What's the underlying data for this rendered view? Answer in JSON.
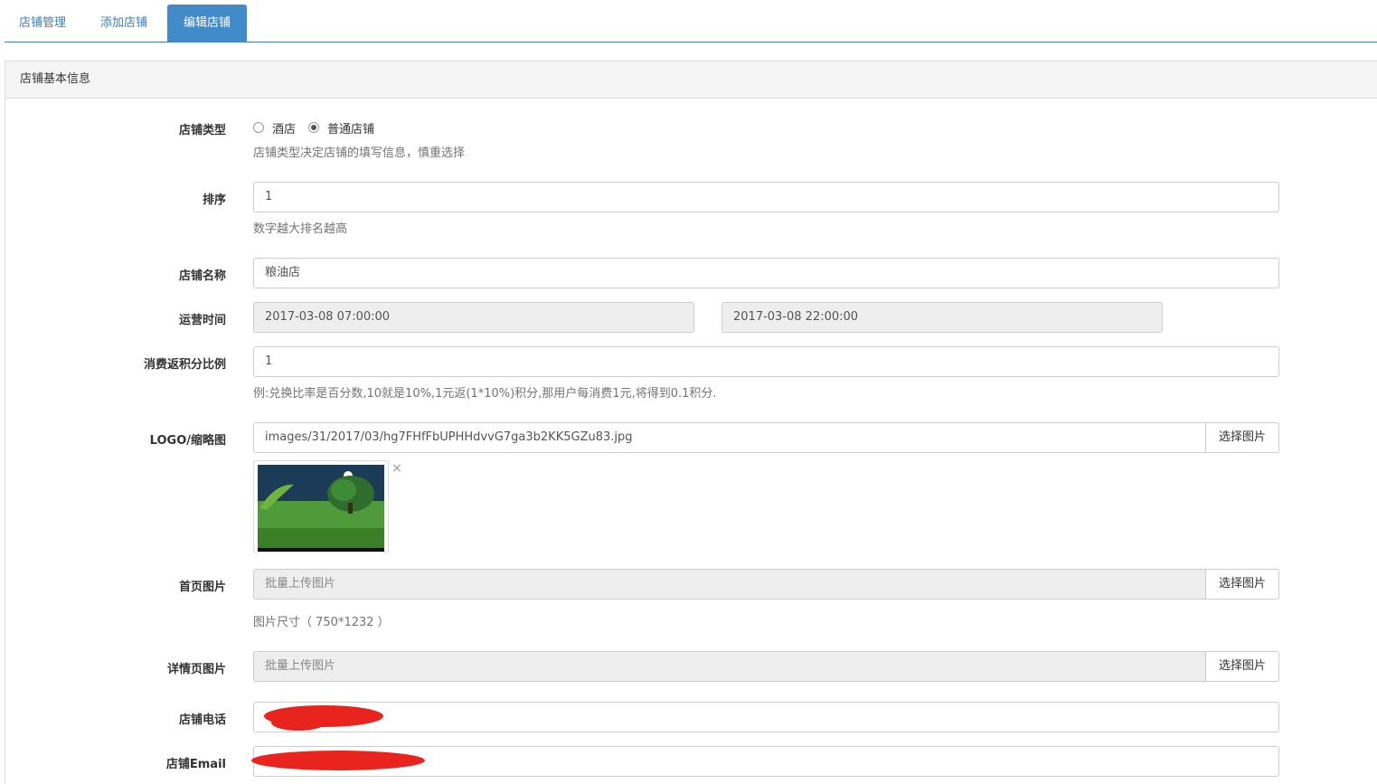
{
  "tabs": [
    {
      "label": "店铺管理"
    },
    {
      "label": "添加店铺"
    },
    {
      "label": "编辑店铺"
    }
  ],
  "panel": {
    "title": "店铺基本信息"
  },
  "form": {
    "store_type": {
      "label": "店铺类型",
      "options": [
        "酒店",
        "普通店铺"
      ],
      "selected": "普通店铺",
      "help": "店铺类型决定店铺的填写信息，慎重选择"
    },
    "sort": {
      "label": "排序",
      "value": "1",
      "help": "数字越大排名越高"
    },
    "name": {
      "label": "店铺名称",
      "value": "粮油店"
    },
    "hours": {
      "label": "运营时间",
      "start": "2017-03-08 07:00:00",
      "end": "2017-03-08 22:00:00"
    },
    "points_ratio": {
      "label": "消费返积分比例",
      "value": "1",
      "help": "例:兑换比率是百分数,10就是10%,1元返(1*10%)积分,那用户每消费1元,将得到0.1积分."
    },
    "logo": {
      "label": "LOGO/缩略图",
      "value": "images/31/2017/03/hg7FHfFbUPHHdvvG7ga3b2KK5GZu83.jpg",
      "button": "选择图片",
      "remove": "×"
    },
    "home_images": {
      "label": "首页图片",
      "placeholder": "批量上传图片",
      "button": "选择图片",
      "help": "图片尺寸（ 750*1232 ）"
    },
    "detail_images": {
      "label": "详情页图片",
      "placeholder": "批量上传图片",
      "button": "选择图片"
    },
    "phone": {
      "label": "店铺电话"
    },
    "email": {
      "label": "店铺Email"
    }
  },
  "colors": {
    "tab_active_bg": "#428bca",
    "tab_text": "#3b7fb6",
    "redaction": "#e9241e"
  }
}
